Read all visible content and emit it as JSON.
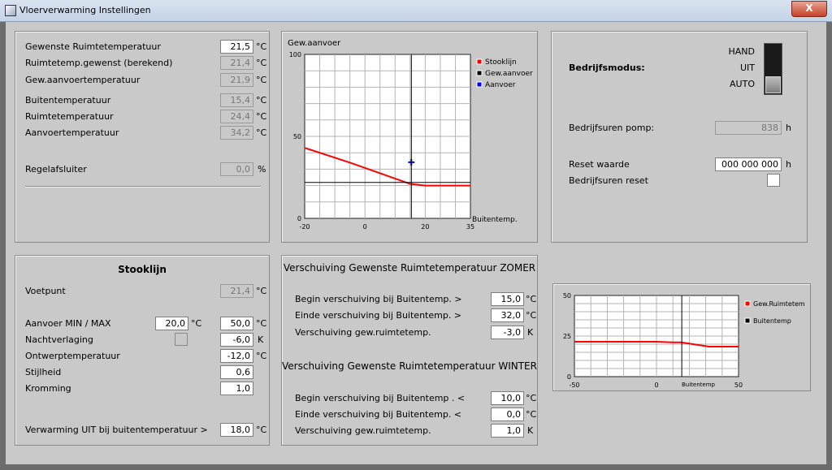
{
  "window": {
    "title": "Vloerverwarming Instellingen",
    "close_label": "X"
  },
  "room": {
    "rows": [
      {
        "label": "Gewenste Ruimtetemperatuur",
        "value": "21,5",
        "unit": "°C",
        "editable": true
      },
      {
        "label": "Ruimtetemp.gewenst (berekend)",
        "value": "21,4",
        "unit": "°C",
        "editable": false
      },
      {
        "label": "Gew.aanvoertemperatuur",
        "value": "21,9",
        "unit": "°C",
        "editable": false
      },
      {
        "label": "Buitentemperatuur",
        "value": "15,4",
        "unit": "°C",
        "editable": false
      },
      {
        "label": "Ruimtetemperatuur",
        "value": "24,4",
        "unit": "°C",
        "editable": false
      },
      {
        "label": "Aanvoertemperatuur",
        "value": "34,2",
        "unit": "°C",
        "editable": false
      },
      {
        "label": "Regelafsluiter",
        "value": "0,0",
        "unit": "%",
        "editable": false
      }
    ]
  },
  "chart_data": [
    {
      "type": "line",
      "title": "Gew.aanvoer",
      "xlabel": "Buitentemp.",
      "xlim": [
        -20,
        35
      ],
      "ylim": [
        0,
        100
      ],
      "xticks": [
        "-20",
        "0",
        "20",
        "35"
      ],
      "yticks": [
        "0",
        "50",
        "100"
      ],
      "grid": true,
      "legend_position": "right",
      "series": [
        {
          "name": "Stooklijn",
          "color": "#ff0000",
          "x": [
            -20,
            -5,
            15,
            20,
            35
          ],
          "y": [
            43,
            34,
            21,
            20,
            20
          ]
        },
        {
          "name": "Gew.aanvoer",
          "color": "#000000",
          "x": [
            -20,
            35
          ],
          "y": [
            21.9,
            21.9
          ]
        },
        {
          "name": "Aanvoer",
          "color": "#0000ff",
          "x": [
            15.4
          ],
          "y": [
            34.2
          ]
        }
      ],
      "marker_x": 15.4
    },
    {
      "type": "line",
      "xlabel": "Buitentemp",
      "xlim": [
        -50,
        50
      ],
      "ylim": [
        0,
        50
      ],
      "xticks": [
        "-50",
        "0",
        "50"
      ],
      "yticks": [
        "0",
        "25",
        "50"
      ],
      "grid": true,
      "legend_position": "right",
      "series": [
        {
          "name": "Gew.Ruimtetem",
          "color": "#ff0000",
          "x": [
            -50,
            0,
            10,
            15,
            32,
            50
          ],
          "y": [
            21.5,
            21.5,
            21.1,
            21.1,
            18.5,
            18.5
          ]
        },
        {
          "name": "Buitentemp",
          "color": "#000000",
          "x": [
            15.4,
            15.4
          ],
          "y": [
            0,
            50
          ]
        }
      ]
    }
  ],
  "mode": {
    "label": "Bedrijfsmodus:",
    "options": [
      "HAND",
      "UIT",
      "AUTO"
    ],
    "selected": "AUTO",
    "pump_hours_label": "Bedrijfsuren pomp:",
    "pump_hours_value": "838",
    "pump_hours_unit": "h",
    "reset_label": "Reset waarde",
    "reset_value": "000 000 000",
    "reset_unit": "h",
    "hours_reset_label": "Bedrijfsuren reset"
  },
  "stooklijn": {
    "title": "Stooklijn",
    "voetpunt_label": "Voetpunt",
    "voetpunt_value": "21,4",
    "voetpunt_unit": "°C",
    "aanvoer_label": "Aanvoer  MIN / MAX",
    "aanvoer_min": "20,0",
    "aanvoer_min_unit": "°C",
    "aanvoer_max": "50,0",
    "aanvoer_max_unit": "°C",
    "nacht_label": "Nachtverlaging",
    "nacht_value": "-6,0",
    "nacht_unit": "K",
    "ontwerp_label": "Ontwerptemperatuur",
    "ontwerp_value": "-12,0",
    "ontwerp_unit": "°C",
    "stijl_label": "Stijlheid",
    "stijl_value": "0,6",
    "kromming_label": "Kromming",
    "kromming_value": "1,0",
    "uit_label": "Verwarming UIT bij buitentemperatuur  >",
    "uit_value": "18,0",
    "uit_unit": "°C"
  },
  "shift": {
    "summer_title": "Verschuiving Gewenste Ruimtetemperatuur ZOMER",
    "summer": [
      {
        "label": "Begin verschuiving bij Buitentemp.  >",
        "value": "15,0",
        "unit": "°C"
      },
      {
        "label": "Einde verschuiving bij Buitentemp.  >",
        "value": "32,0",
        "unit": "°C"
      },
      {
        "label": "Verschuiving gew.ruimtetemp.",
        "value": "-3,0",
        "unit": "K"
      }
    ],
    "winter_title": "Verschuiving Gewenste Ruimtetemperatuur WINTER",
    "winter": [
      {
        "label": "Begin verschuiving bij Buitentemp .  <",
        "value": "10,0",
        "unit": "°C"
      },
      {
        "label": "Einde verschuiving bij Buitentemp.  <",
        "value": "0,0",
        "unit": "°C"
      },
      {
        "label": "Verschuiving gew.ruimtetemp.",
        "value": "1,0",
        "unit": "K"
      }
    ]
  }
}
